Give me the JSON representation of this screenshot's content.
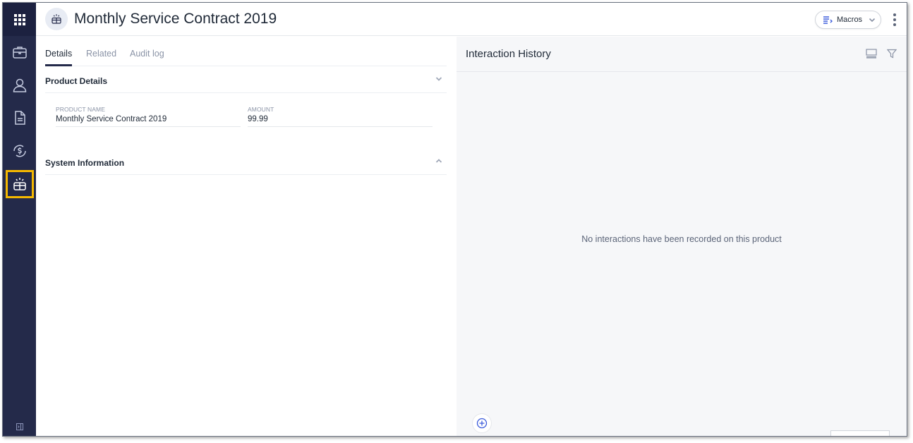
{
  "header": {
    "title": "Monthly Service Contract 2019",
    "macros_label": "Macros"
  },
  "sidebar": {
    "items": [
      {
        "name": "briefcase-icon"
      },
      {
        "name": "person-icon"
      },
      {
        "name": "document-icon"
      },
      {
        "name": "dollar-cycle-icon"
      },
      {
        "name": "product-box-icon",
        "active": true
      }
    ],
    "active_color": "#f5b800",
    "background": "#242a4a"
  },
  "tabs": [
    {
      "label": "Details",
      "active": true
    },
    {
      "label": "Related",
      "active": false
    },
    {
      "label": "Audit log",
      "active": false
    }
  ],
  "product_details": {
    "title": "Product Details",
    "fields": {
      "product_name": {
        "label": "PRODUCT NAME",
        "value": "Monthly Service Contract 2019"
      },
      "amount": {
        "label": "AMOUNT",
        "value": "99.99"
      }
    }
  },
  "system_information": {
    "title": "System Information"
  },
  "interaction_history": {
    "title": "Interaction History",
    "empty_message": "No interactions have been recorded on this product"
  }
}
